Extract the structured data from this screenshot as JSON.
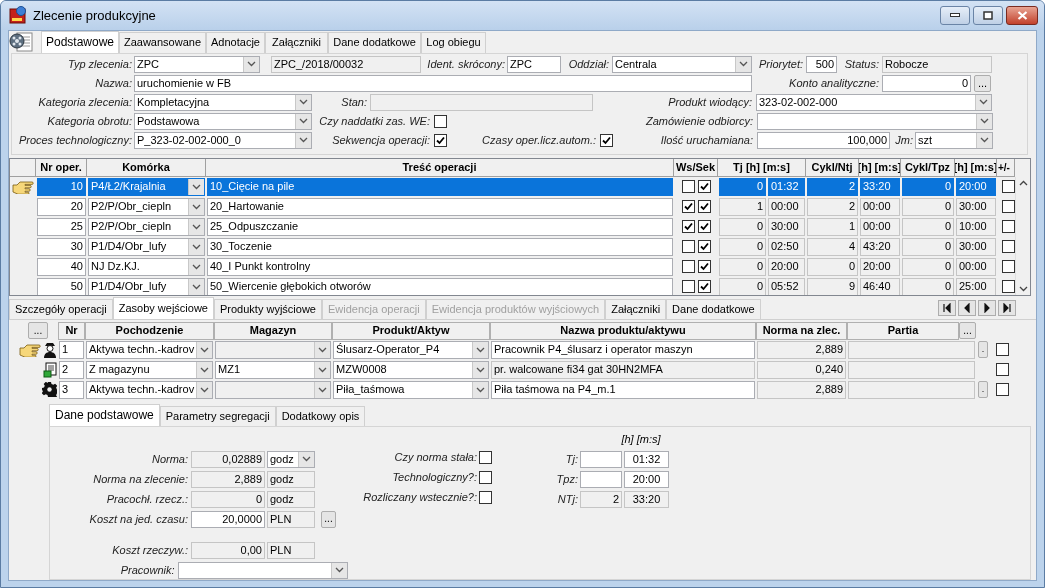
{
  "window": {
    "title": "Zlecenie produkcyjne"
  },
  "tabs": [
    {
      "label": "Podstawowe",
      "selected": true
    },
    {
      "label": "Zaawansowane",
      "selected": false
    },
    {
      "label": "Adnotacje",
      "selected": false
    },
    {
      "label": "Załączniki",
      "selected": false
    },
    {
      "label": "Dane dodatkowe",
      "selected": false
    },
    {
      "label": "Log obiegu",
      "selected": false
    }
  ],
  "form": {
    "fields": [
      {
        "label": "Typ zlecenia:",
        "kind": "combo",
        "value": "ZPC"
      },
      {
        "kind": "readonly",
        "value": "ZPC_/2018/00032"
      },
      {
        "label": "Ident. skrócony:",
        "kind": "input",
        "value": "ZPC"
      },
      {
        "label": "Oddział:",
        "kind": "combo",
        "value": "Centrala"
      },
      {
        "label": "Priorytet:",
        "kind": "number",
        "value": "500"
      },
      {
        "label": "Status:",
        "kind": "readonly",
        "value": "Robocze"
      },
      {
        "label": "Nazwa:",
        "kind": "input",
        "value": "uruchomienie w FB"
      },
      {
        "label": "Konto analityczne:",
        "kind": "number",
        "value": "0"
      },
      {
        "kind": "button",
        "text": "..."
      },
      {
        "label": "Kategoria zlecenia:",
        "kind": "combo",
        "value": "Kompletacyjna"
      },
      {
        "label": "Stan:",
        "kind": "readonly"
      },
      {
        "label": "Produkt wiodący:",
        "kind": "combo",
        "value": "323-02-002-000"
      },
      {
        "label": "Kategoria obrotu:",
        "kind": "combo",
        "value": "Podstawowa"
      },
      {
        "label": "Czy naddatki zas. WE:",
        "kind": "checkbox",
        "checked": false
      },
      {
        "label": "Zamówienie odbiorcy:",
        "kind": "combo"
      },
      {
        "label": "Proces technologiczny:",
        "kind": "combo",
        "value": "P_323-02-002-000_0"
      },
      {
        "label": "Sekwencja operacji:",
        "kind": "checkbox",
        "checked": true
      },
      {
        "label": "Czasy oper.licz.autom.:",
        "kind": "checkbox",
        "checked": true
      },
      {
        "label": "Ilość uruchamiana:",
        "kind": "number",
        "value": "100,000"
      },
      {
        "label": "Jm:",
        "kind": "combo",
        "value": "szt"
      }
    ]
  },
  "operations": {
    "columns": [
      "Nr oper.",
      "Komórka",
      "Treść operacji",
      "Ws/Sek",
      "Tj [h] [m:s]",
      "Cykl/Ntj",
      "[h] [m:s]",
      "Cykl/Tpz",
      "[h] [m:s]",
      "+/-"
    ],
    "rows": [
      {
        "nr": "10",
        "cell": "P4/Ł2/Krajalnia",
        "name": "10_Cięcie na pile",
        "ws": false,
        "sek": true,
        "tj": "0",
        "tj_time": "01:32",
        "ntj": "2",
        "ntj_time": "33:20",
        "tpz": "0",
        "tpz_time": "20:00",
        "plus_minus": false,
        "selected": true
      },
      {
        "nr": "20",
        "cell": "P2/P/Obr_ciepln",
        "name": "20_Hartowanie",
        "ws": true,
        "sek": true,
        "tj": "1",
        "tj_time": "00:00",
        "ntj": "2",
        "ntj_time": "00:00",
        "tpz": "0",
        "tpz_time": "30:00",
        "plus_minus": false,
        "selected": false
      },
      {
        "nr": "25",
        "cell": "P2/P/Obr_ciepln",
        "name": "25_Odpuszczanie",
        "ws": true,
        "sek": true,
        "tj": "0",
        "tj_time": "30:00",
        "ntj": "1",
        "ntj_time": "00:00",
        "tpz": "0",
        "tpz_time": "10:00",
        "plus_minus": false,
        "selected": false
      },
      {
        "nr": "30",
        "cell": "P1/D4/Obr_lufy",
        "name": "30_Toczenie",
        "ws": false,
        "sek": true,
        "tj": "0",
        "tj_time": "02:50",
        "ntj": "4",
        "ntj_time": "43:20",
        "tpz": "0",
        "tpz_time": "30:00",
        "plus_minus": false,
        "selected": false
      },
      {
        "nr": "40",
        "cell": "NJ Dz.KJ.",
        "name": "40_I Punkt kontrolny",
        "ws": false,
        "sek": true,
        "tj": "0",
        "tj_time": "20:00",
        "ntj": "0",
        "ntj_time": "20:00",
        "tpz": "0",
        "tpz_time": "00:00",
        "plus_minus": false,
        "selected": false
      },
      {
        "nr": "50",
        "cell": "P1/D4/Obr_lufy",
        "name": "50_Wiercenie głębokich otworów",
        "ws": false,
        "sek": true,
        "tj": "0",
        "tj_time": "05:52",
        "ntj": "9",
        "ntj_time": "46:40",
        "tpz": "0",
        "tpz_time": "25:00",
        "plus_minus": false,
        "selected": false
      }
    ]
  },
  "lower_tabs": [
    {
      "label": "Szczegóły operacji",
      "selected": false,
      "disabled": false
    },
    {
      "label": "Zasoby wejściowe",
      "selected": true,
      "disabled": false
    },
    {
      "label": "Produkty wyjściowe",
      "selected": false,
      "disabled": false
    },
    {
      "label": "Ewidencja operacji",
      "selected": false,
      "disabled": true
    },
    {
      "label": "Ewidencja produktów wyjściowych",
      "selected": false,
      "disabled": true
    },
    {
      "label": "Załączniki",
      "selected": false,
      "disabled": false
    },
    {
      "label": "Dane dodatkowe",
      "selected": false,
      "disabled": false
    }
  ],
  "resources": {
    "header_buttons": [
      "...",
      "..."
    ],
    "columns": [
      "Nr",
      "Pochodzenie",
      "Magazyn",
      "Produkt/Aktyw",
      "Nazwa produktu/aktywu",
      "Norma na zlec.",
      "Partia"
    ],
    "rows": [
      {
        "kind": "person",
        "current": true,
        "nr": "1",
        "origin": "Aktywa techn.-kadrov",
        "warehouse_enabled": false,
        "product": "Ślusarz-Operator_P4",
        "name": "Pracownik P4_ślusarz i operator maszyn",
        "norm": "2,889",
        "button": ".",
        "checked": false
      },
      {
        "kind": "document",
        "current": false,
        "nr": "2",
        "origin": "Z magazynu",
        "warehouse": "MZ1",
        "warehouse_enabled": true,
        "product": "MZW0008",
        "name": "pr. walcowane fi34 gat 30HN2MFA",
        "norm": "0,240",
        "checked": false
      },
      {
        "kind": "gear",
        "current": false,
        "nr": "3",
        "origin": "Aktywa techn.-kadrov",
        "warehouse_enabled": false,
        "product": "Piła_taśmowa",
        "name": "Piła taśmowa na P4_m.1",
        "norm": "2,889",
        "button": ".",
        "checked": false
      }
    ]
  },
  "detail": {
    "tabs": [
      {
        "label": "Dane podstawowe",
        "selected": true
      },
      {
        "label": "Parametry segregacji",
        "selected": false
      },
      {
        "label": "Dodatkowy opis",
        "selected": false
      }
    ],
    "fields": [
      {
        "label": "Norma:",
        "value": "0,02889",
        "unit": "godz",
        "unit_dropdown": true,
        "editable": false
      },
      {
        "label": "Norma na zlecenie:",
        "value": "2,889",
        "unit": "godz",
        "unit_dropdown": false,
        "editable": false
      },
      {
        "label": "Pracochł. rzecz.:",
        "value": "0",
        "unit": "godz",
        "unit_dropdown": false,
        "editable": false
      },
      {
        "label": "Koszt na jed. czasu:",
        "value": "20,0000",
        "unit": "PLN",
        "unit_dropdown": false,
        "editable": true,
        "button": "..."
      }
    ],
    "cost": {
      "label": "Koszt rzeczyw.:",
      "value": "0,00",
      "unit": "PLN"
    },
    "employee": {
      "label": "Pracownik:"
    },
    "flags": [
      {
        "label": "Czy norma stała:",
        "checked": false
      },
      {
        "label": "Technologiczny?:",
        "checked": false
      },
      {
        "label": "Rozliczany wstecznie?:",
        "checked": false
      }
    ],
    "times": {
      "header": "[h] [m:s]",
      "rows": [
        {
          "label": "Tj:",
          "time": "01:32",
          "editable": true
        },
        {
          "label": "Tpz:",
          "time": "20:00",
          "editable": true
        },
        {
          "label": "NTj:",
          "hours": "2",
          "time": "33:20",
          "editable": false
        }
      ]
    }
  }
}
